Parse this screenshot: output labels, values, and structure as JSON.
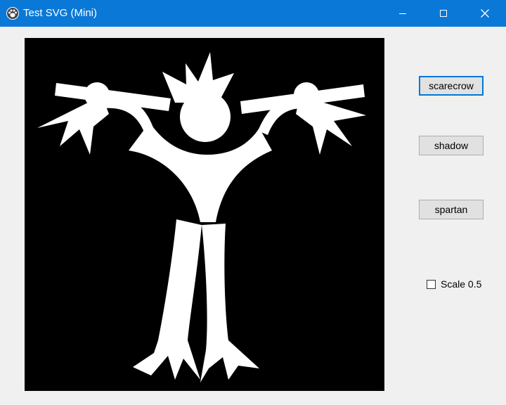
{
  "window": {
    "title": "Test SVG (Mini)",
    "titlebar_color": "#0a78d7",
    "icon": "paw-icon",
    "controls": {
      "minimize": "minimize-icon",
      "maximize": "maximize-icon",
      "close": "close-icon"
    }
  },
  "canvas": {
    "background": "#000000",
    "figure": "scarecrow",
    "figure_color": "#ffffff"
  },
  "buttons": {
    "scarecrow": "scarecrow",
    "shadow": "shadow",
    "spartan": "spartan"
  },
  "scale_checkbox": {
    "label": "Scale 0.5",
    "checked": false
  }
}
